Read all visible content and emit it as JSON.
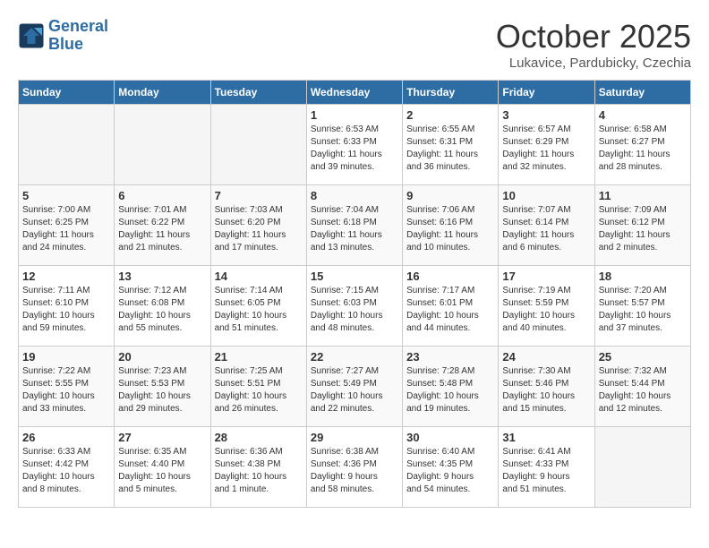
{
  "logo": {
    "line1": "General",
    "line2": "Blue"
  },
  "title": "October 2025",
  "location": "Lukavice, Pardubicky, Czechia",
  "weekdays": [
    "Sunday",
    "Monday",
    "Tuesday",
    "Wednesday",
    "Thursday",
    "Friday",
    "Saturday"
  ],
  "weeks": [
    [
      {
        "day": "",
        "info": ""
      },
      {
        "day": "",
        "info": ""
      },
      {
        "day": "",
        "info": ""
      },
      {
        "day": "1",
        "info": "Sunrise: 6:53 AM\nSunset: 6:33 PM\nDaylight: 11 hours\nand 39 minutes."
      },
      {
        "day": "2",
        "info": "Sunrise: 6:55 AM\nSunset: 6:31 PM\nDaylight: 11 hours\nand 36 minutes."
      },
      {
        "day": "3",
        "info": "Sunrise: 6:57 AM\nSunset: 6:29 PM\nDaylight: 11 hours\nand 32 minutes."
      },
      {
        "day": "4",
        "info": "Sunrise: 6:58 AM\nSunset: 6:27 PM\nDaylight: 11 hours\nand 28 minutes."
      }
    ],
    [
      {
        "day": "5",
        "info": "Sunrise: 7:00 AM\nSunset: 6:25 PM\nDaylight: 11 hours\nand 24 minutes."
      },
      {
        "day": "6",
        "info": "Sunrise: 7:01 AM\nSunset: 6:22 PM\nDaylight: 11 hours\nand 21 minutes."
      },
      {
        "day": "7",
        "info": "Sunrise: 7:03 AM\nSunset: 6:20 PM\nDaylight: 11 hours\nand 17 minutes."
      },
      {
        "day": "8",
        "info": "Sunrise: 7:04 AM\nSunset: 6:18 PM\nDaylight: 11 hours\nand 13 minutes."
      },
      {
        "day": "9",
        "info": "Sunrise: 7:06 AM\nSunset: 6:16 PM\nDaylight: 11 hours\nand 10 minutes."
      },
      {
        "day": "10",
        "info": "Sunrise: 7:07 AM\nSunset: 6:14 PM\nDaylight: 11 hours\nand 6 minutes."
      },
      {
        "day": "11",
        "info": "Sunrise: 7:09 AM\nSunset: 6:12 PM\nDaylight: 11 hours\nand 2 minutes."
      }
    ],
    [
      {
        "day": "12",
        "info": "Sunrise: 7:11 AM\nSunset: 6:10 PM\nDaylight: 10 hours\nand 59 minutes."
      },
      {
        "day": "13",
        "info": "Sunrise: 7:12 AM\nSunset: 6:08 PM\nDaylight: 10 hours\nand 55 minutes."
      },
      {
        "day": "14",
        "info": "Sunrise: 7:14 AM\nSunset: 6:05 PM\nDaylight: 10 hours\nand 51 minutes."
      },
      {
        "day": "15",
        "info": "Sunrise: 7:15 AM\nSunset: 6:03 PM\nDaylight: 10 hours\nand 48 minutes."
      },
      {
        "day": "16",
        "info": "Sunrise: 7:17 AM\nSunset: 6:01 PM\nDaylight: 10 hours\nand 44 minutes."
      },
      {
        "day": "17",
        "info": "Sunrise: 7:19 AM\nSunset: 5:59 PM\nDaylight: 10 hours\nand 40 minutes."
      },
      {
        "day": "18",
        "info": "Sunrise: 7:20 AM\nSunset: 5:57 PM\nDaylight: 10 hours\nand 37 minutes."
      }
    ],
    [
      {
        "day": "19",
        "info": "Sunrise: 7:22 AM\nSunset: 5:55 PM\nDaylight: 10 hours\nand 33 minutes."
      },
      {
        "day": "20",
        "info": "Sunrise: 7:23 AM\nSunset: 5:53 PM\nDaylight: 10 hours\nand 29 minutes."
      },
      {
        "day": "21",
        "info": "Sunrise: 7:25 AM\nSunset: 5:51 PM\nDaylight: 10 hours\nand 26 minutes."
      },
      {
        "day": "22",
        "info": "Sunrise: 7:27 AM\nSunset: 5:49 PM\nDaylight: 10 hours\nand 22 minutes."
      },
      {
        "day": "23",
        "info": "Sunrise: 7:28 AM\nSunset: 5:48 PM\nDaylight: 10 hours\nand 19 minutes."
      },
      {
        "day": "24",
        "info": "Sunrise: 7:30 AM\nSunset: 5:46 PM\nDaylight: 10 hours\nand 15 minutes."
      },
      {
        "day": "25",
        "info": "Sunrise: 7:32 AM\nSunset: 5:44 PM\nDaylight: 10 hours\nand 12 minutes."
      }
    ],
    [
      {
        "day": "26",
        "info": "Sunrise: 6:33 AM\nSunset: 4:42 PM\nDaylight: 10 hours\nand 8 minutes."
      },
      {
        "day": "27",
        "info": "Sunrise: 6:35 AM\nSunset: 4:40 PM\nDaylight: 10 hours\nand 5 minutes."
      },
      {
        "day": "28",
        "info": "Sunrise: 6:36 AM\nSunset: 4:38 PM\nDaylight: 10 hours\nand 1 minute."
      },
      {
        "day": "29",
        "info": "Sunrise: 6:38 AM\nSunset: 4:36 PM\nDaylight: 9 hours\nand 58 minutes."
      },
      {
        "day": "30",
        "info": "Sunrise: 6:40 AM\nSunset: 4:35 PM\nDaylight: 9 hours\nand 54 minutes."
      },
      {
        "day": "31",
        "info": "Sunrise: 6:41 AM\nSunset: 4:33 PM\nDaylight: 9 hours\nand 51 minutes."
      },
      {
        "day": "",
        "info": ""
      }
    ]
  ]
}
